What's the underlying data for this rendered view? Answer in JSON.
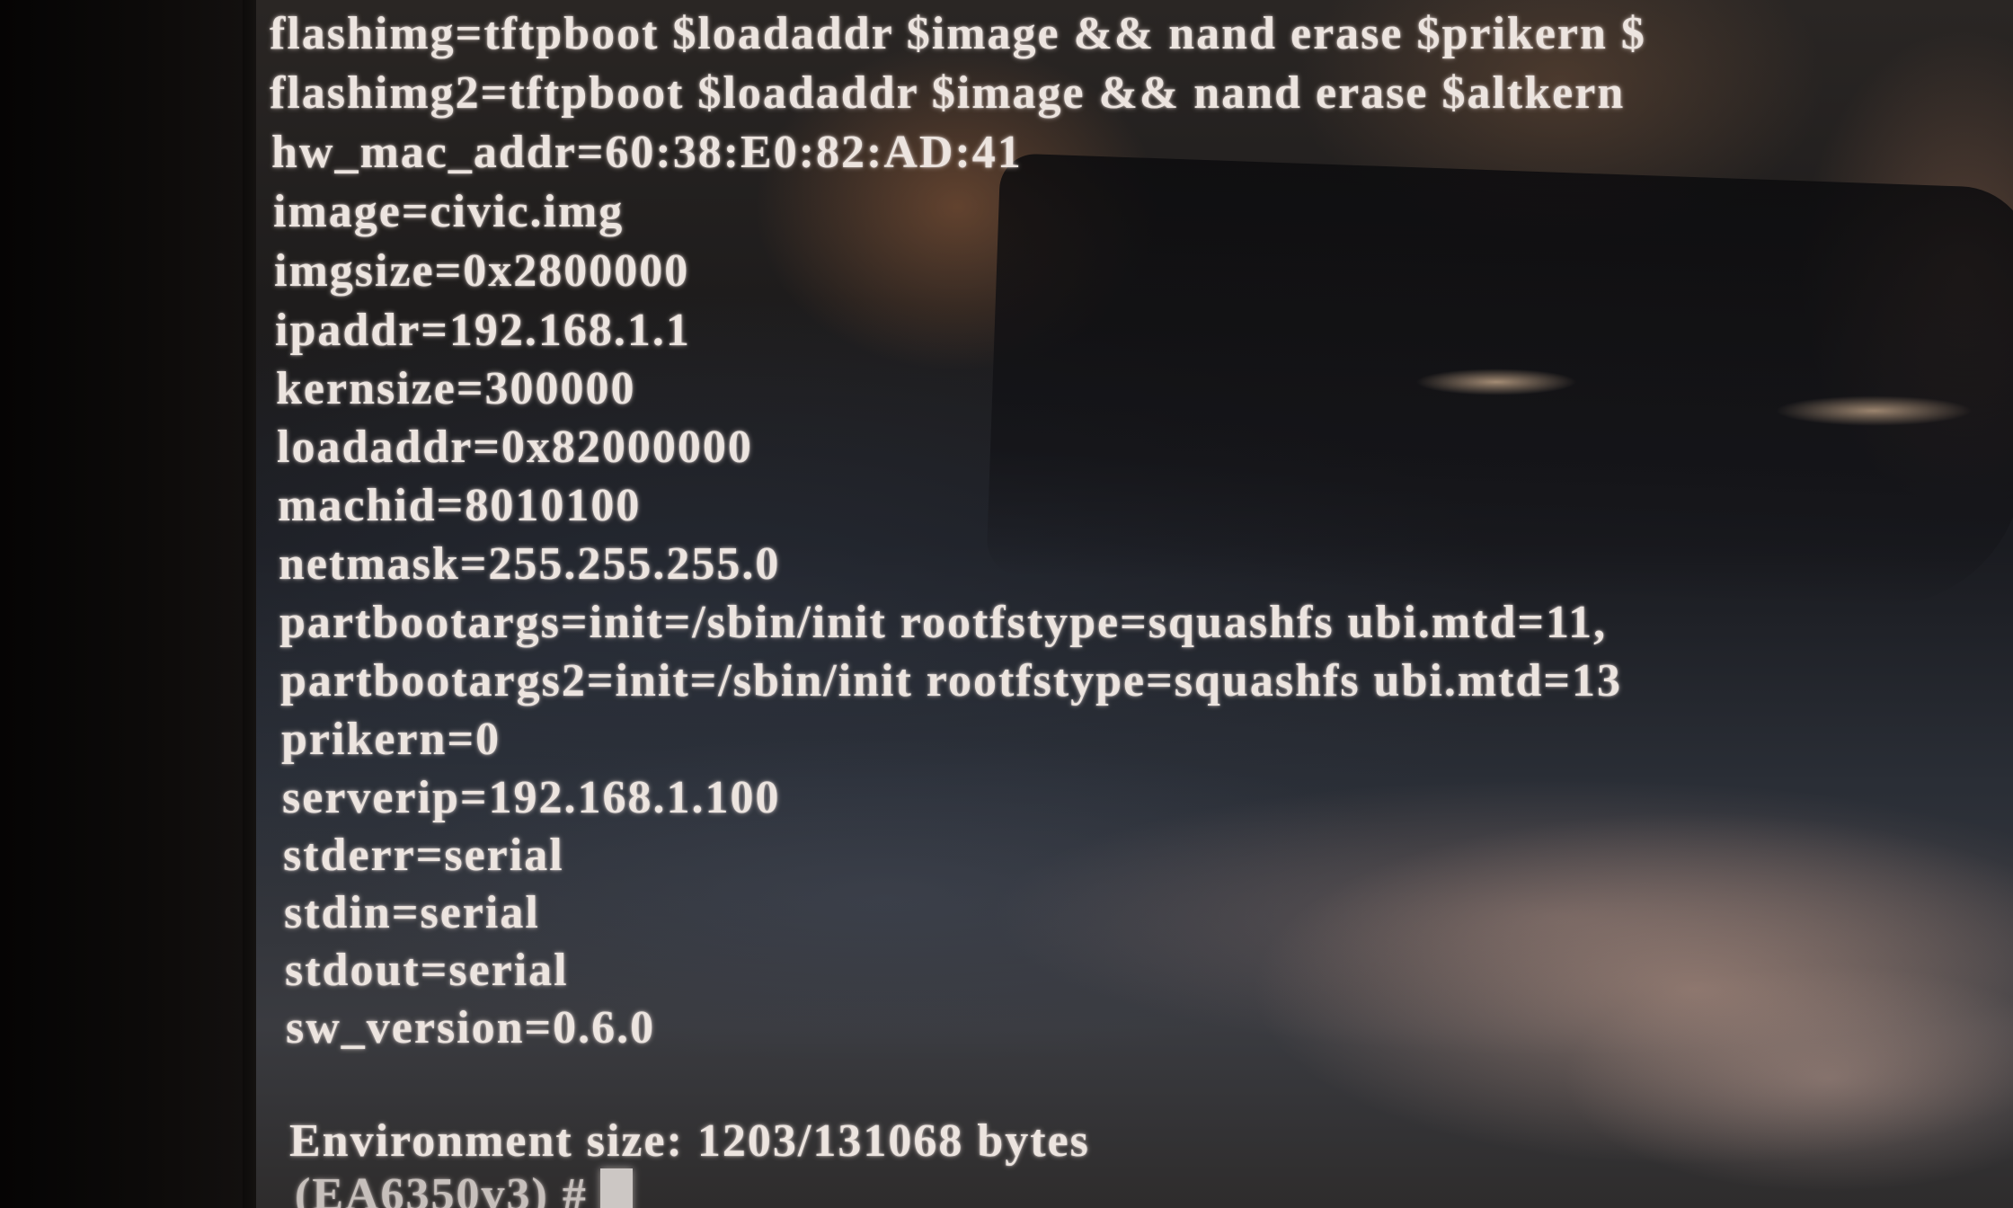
{
  "terminal": {
    "lines": [
      "flashimg=tftpboot $loadaddr $image && nand erase $prikern $",
      "flashimg2=tftpboot $loadaddr $image && nand erase $altkern",
      "hw_mac_addr=60:38:E0:82:AD:41",
      "image=civic.img",
      "imgsize=0x2800000",
      "ipaddr=192.168.1.1",
      "kernsize=300000",
      "loadaddr=0x82000000",
      "machid=8010100",
      "netmask=255.255.255.0",
      "partbootargs=init=/sbin/init rootfstype=squashfs ubi.mtd=11,",
      "partbootargs2=init=/sbin/init rootfstype=squashfs ubi.mtd=13",
      "prikern=0",
      "serverip=192.168.1.100",
      "stderr=serial",
      "stdin=serial",
      "stdout=serial",
      "sw_version=0.6.0",
      "",
      "Environment size: 1203/131068 bytes"
    ],
    "prompt": "(EA6350v3) #"
  }
}
